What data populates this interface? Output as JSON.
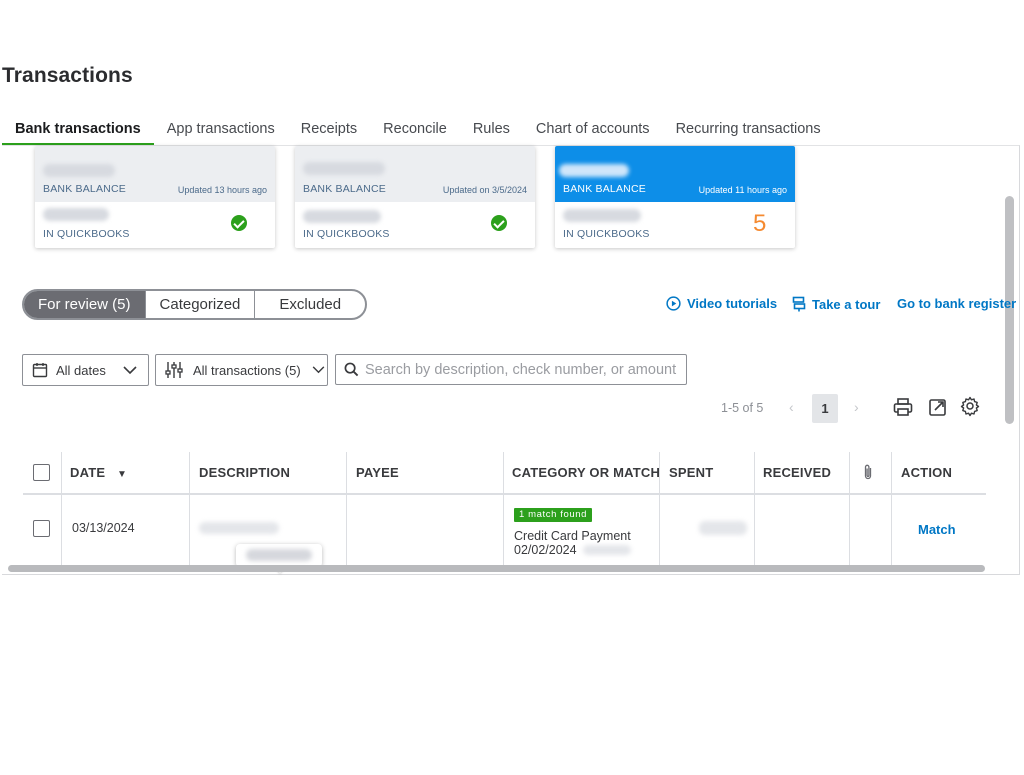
{
  "page": {
    "title": "Transactions"
  },
  "tabs": [
    {
      "label": "Bank transactions",
      "active": true
    },
    {
      "label": "App transactions"
    },
    {
      "label": "Receipts"
    },
    {
      "label": "Reconcile"
    },
    {
      "label": "Rules"
    },
    {
      "label": "Chart of accounts"
    },
    {
      "label": "Recurring transactions"
    }
  ],
  "cards": [
    {
      "bank_label": "BANK BALANCE",
      "updated": "Updated 13 hours ago",
      "qb_label": "IN QUICKBOOKS",
      "status": "check-icon"
    },
    {
      "bank_label": "BANK BALANCE",
      "updated": "Updated on 3/5/2024",
      "qb_label": "IN QUICKBOOKS",
      "status": "check-icon"
    },
    {
      "bank_label": "BANK BALANCE",
      "updated": "Updated 11 hours ago",
      "qb_label": "IN QUICKBOOKS",
      "count": "5",
      "selected": true
    }
  ],
  "segments": [
    {
      "label": "For review (5)",
      "active": true
    },
    {
      "label": "Categorized"
    },
    {
      "label": "Excluded"
    }
  ],
  "links": {
    "video": "Video tutorials",
    "tour": "Take a tour",
    "register": "Go to bank register"
  },
  "filters": {
    "dates": "All dates",
    "transactions": "All transactions (5)",
    "search_placeholder": "Search by description, check number, or amount"
  },
  "pager": {
    "range": "1-5 of 5",
    "current": "1",
    "prev": "‹",
    "next": "›"
  },
  "table": {
    "headers": {
      "date": "DATE",
      "sort_indicator": "▼",
      "description": "DESCRIPTION",
      "payee": "PAYEE",
      "category": "CATEGORY OR MATCH",
      "spent": "SPENT",
      "received": "RECEIVED",
      "action": "ACTION"
    },
    "rows": [
      {
        "date": "03/13/2024",
        "badge": "1 match found",
        "match_title": "Credit Card Payment",
        "match_date": "02/02/2024",
        "action": "Match"
      }
    ]
  },
  "colors": {
    "accent_green": "#2ca01c",
    "link_blue": "#0077c5",
    "selected_card": "#0d8ee8",
    "count_orange": "#f58a30"
  }
}
